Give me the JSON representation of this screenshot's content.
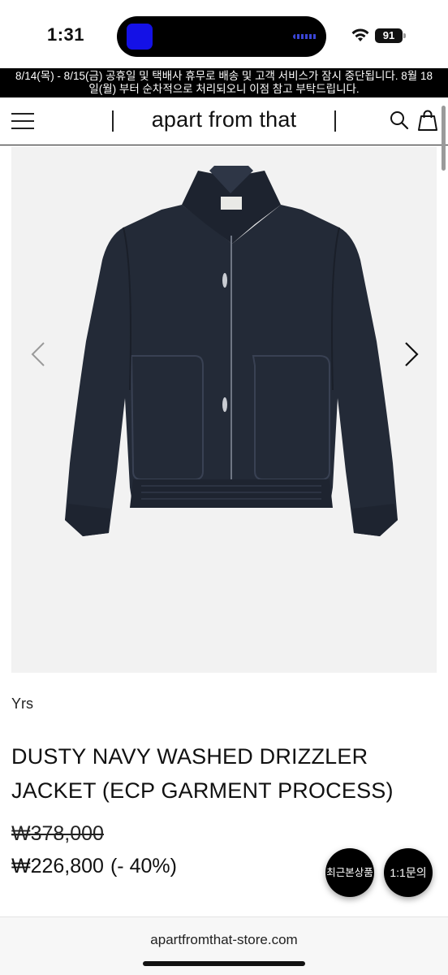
{
  "status_bar": {
    "time": "1:31",
    "battery": "91",
    "icons": [
      "wifi-icon",
      "battery-icon"
    ]
  },
  "notice": {
    "line1": "8/14(목) - 8/15(금) 공휴일 및 택배사 휴무로 배송 및 고객 서비스가 잠시 중단됩니다. 8월 18",
    "line2": "일(월) 부터 순차적으로 처리되오니 이점 참고 부탁드립니다."
  },
  "header": {
    "logo": "apart from that",
    "icons": [
      "hamburger-menu-icon",
      "search-icon",
      "shopping-bag-icon"
    ]
  },
  "gallery": {
    "icons": [
      "chevron-left-icon",
      "chevron-right-icon"
    ]
  },
  "product": {
    "brand": "Yrs",
    "title_line1": "DUSTY NAVY WASHED DRIZZLER",
    "title_line2": "JACKET (ECP GARMENT PROCESS)",
    "original_price": "₩378,000",
    "sale_price": "₩226,800",
    "discount": "(- 40%)"
  },
  "floating_buttons": {
    "recent": "최근본상품",
    "inquiry": "1:1문의"
  },
  "browser": {
    "url": "apartfromthat-store.com"
  },
  "colors": {
    "jacket": "#232a37",
    "image_bg": "#f2f2f2",
    "notice_bg": "#000000"
  }
}
